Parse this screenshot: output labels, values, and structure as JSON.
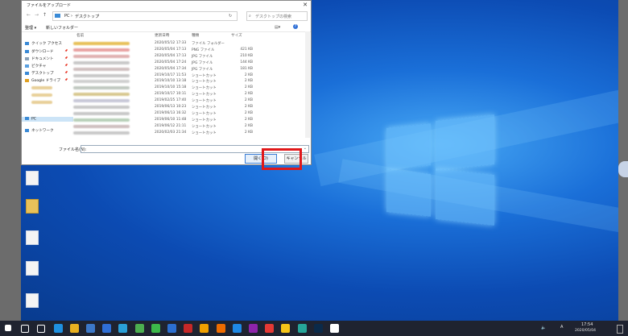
{
  "dialog": {
    "title": "ファイルをアップロード",
    "close_glyph": "✕",
    "nav": {
      "back": "←",
      "forward": "→",
      "up": "↑",
      "address_parts": [
        "PC",
        "›",
        "デスクトップ",
        "›"
      ],
      "refresh": "↻",
      "search_placeholder": "デスクトップの検索"
    },
    "toolbar": {
      "organize": "整理 ▾",
      "new_folder": "新しいフォルダー",
      "view": "▤▾",
      "help": "?"
    },
    "sidebar": {
      "items": [
        {
          "label": "クイック アクセス",
          "icon": "star-icon",
          "color": "#3a8ad6"
        },
        {
          "label": "ダウンロード",
          "icon": "download-icon",
          "color": "#3a8ad6",
          "pin": "📌"
        },
        {
          "label": "ドキュメント",
          "icon": "document-icon",
          "color": "#8aa1b8",
          "pin": "📌"
        },
        {
          "label": "ピクチャ",
          "icon": "picture-icon",
          "color": "#5aa0e0",
          "pin": "📌"
        },
        {
          "label": "デスクトップ",
          "icon": "desktop-icon",
          "color": "#3a8ad6",
          "pin": "📌"
        },
        {
          "label": "Google ドライブ",
          "icon": "google-drive-icon",
          "color": "#e0a020",
          "pin": "📌"
        },
        {
          "label": "PC",
          "icon": "pc-icon",
          "color": "#3a8ad6"
        },
        {
          "label": "ネットワーク",
          "icon": "network-icon",
          "color": "#3a8ad6"
        }
      ]
    },
    "columns": {
      "name": "名前",
      "date": "更新日時",
      "type": "種類",
      "size": "サイズ"
    },
    "files": [
      {
        "date": "2020/05/12 17:33",
        "type": "ファイル フォルダー",
        "size": "",
        "color": "#e8c15a"
      },
      {
        "date": "2020/05/04 17:13",
        "type": "PNG ファイル",
        "size": "421 KB",
        "color": "#e8a0a0"
      },
      {
        "date": "2020/05/04 17:13",
        "type": "JPG ファイル",
        "size": "210 KB",
        "color": "#e0b0b0"
      },
      {
        "date": "2020/05/04 17:24",
        "type": "JPG ファイル",
        "size": "144 KB",
        "color": "#c8c8c8"
      },
      {
        "date": "2020/05/04 17:34",
        "type": "JPG ファイル",
        "size": "181 KB",
        "color": "#d0c0c0"
      },
      {
        "date": "2019/10/17 11:53",
        "type": "ショートカット",
        "size": "2 KB",
        "color": "#c8c8c8"
      },
      {
        "date": "2019/10/10 13:18",
        "type": "ショートカット",
        "size": "2 KB",
        "color": "#d0d0d0"
      },
      {
        "date": "2019/10/10 15:18",
        "type": "ショートカット",
        "size": "2 KB",
        "color": "#c0c8c0"
      },
      {
        "date": "2019/10/17 10:11",
        "type": "ショートカット",
        "size": "2 KB",
        "color": "#d8c890"
      },
      {
        "date": "2019/02/25 17:40",
        "type": "ショートカット",
        "size": "2 KB",
        "color": "#c8c8d8"
      },
      {
        "date": "2019/06/13 10:23",
        "type": "ショートカット",
        "size": "2 KB",
        "color": "#c8c8c8"
      },
      {
        "date": "2019/06/13 16:32",
        "type": "ショートカット",
        "size": "2 KB",
        "color": "#c8c8c8"
      },
      {
        "date": "2019/06/10 11:48",
        "type": "ショートカット",
        "size": "2 KB",
        "color": "#b8d0b8"
      },
      {
        "date": "2019/06/12 21:11",
        "type": "ショートカット",
        "size": "2 KB",
        "color": "#d0c0c0"
      },
      {
        "date": "2020/02/03 21:34",
        "type": "ショートカット",
        "size": "2 KB",
        "color": "#c8c8c8"
      }
    ],
    "filename_label": "ファイル名(N):",
    "filename_value": "",
    "open_button": "開く(O)",
    "cancel_button": "キャンセル",
    "highlight_color": "#e0181a"
  },
  "taskbar": {
    "icons": [
      {
        "name": "start-icon",
        "color": "#ffffff"
      },
      {
        "name": "search-icon",
        "color": "#ffffff"
      },
      {
        "name": "task-view-icon",
        "color": "#ffffff"
      },
      {
        "name": "edge-icon",
        "color": "#1e90e0"
      },
      {
        "name": "chrome-icon",
        "color": "#e8b020"
      },
      {
        "name": "app-icon",
        "color": "#3c78c8"
      },
      {
        "name": "app-icon",
        "color": "#2f6fd6"
      },
      {
        "name": "app-icon",
        "color": "#2aa0d8"
      },
      {
        "name": "app-icon",
        "color": "#4caf50"
      },
      {
        "name": "line-icon",
        "color": "#3cb84a"
      },
      {
        "name": "app-icon",
        "color": "#2c6fd0"
      },
      {
        "name": "filezilla-icon",
        "color": "#c62828"
      },
      {
        "name": "app-icon",
        "color": "#f0a000"
      },
      {
        "name": "app-icon",
        "color": "#ef6c00"
      },
      {
        "name": "app-icon",
        "color": "#1e88e5"
      },
      {
        "name": "app-icon",
        "color": "#8e24aa"
      },
      {
        "name": "app-icon",
        "color": "#e53935"
      },
      {
        "name": "app-icon",
        "color": "#f5c518"
      },
      {
        "name": "app-icon",
        "color": "#26a69a"
      },
      {
        "name": "photoshop-icon",
        "color": "#0b2a4a"
      },
      {
        "name": "explorer-icon",
        "color": "#ffffff"
      }
    ],
    "tray": {
      "ime": "A",
      "time": "17:54",
      "date": "2020/05/04"
    }
  }
}
